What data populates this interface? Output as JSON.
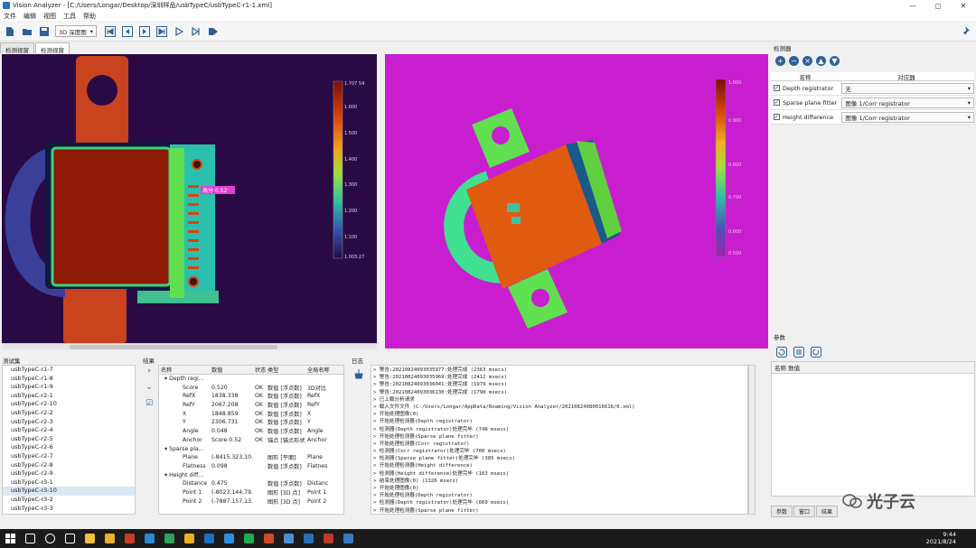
{
  "window": {
    "title": "Vision Analyzer - [C:/Users/Longar/Desktop/深圳样品/usbTypeC/usbTypeC-r1-1.xml]",
    "controls": [
      "—",
      "◻",
      "✕"
    ]
  },
  "menu": [
    "文件",
    "编辑",
    "视图",
    "工具",
    "帮助"
  ],
  "toolbar": {
    "view_combo": "3D 深度图"
  },
  "view_tabs": [
    "检测视窗",
    "检测视窗"
  ],
  "left_view": {
    "scale_labels": [
      "1.707 54",
      "1.600",
      "1.500",
      "1.400",
      "1.300",
      "1.200",
      "1.100",
      "1.003 27"
    ],
    "annotation": "高分 0.52"
  },
  "right_view": {
    "scale_labels": [
      "1.000",
      "0.900",
      "0.800",
      "0.700",
      "0.600",
      "0.500"
    ]
  },
  "detectors": {
    "title": "检测器",
    "buttons": [
      "+",
      "−",
      "×",
      "▲",
      "▼"
    ],
    "col_name": "名称",
    "col_ref": "对应器",
    "rows": [
      {
        "name": "Depth registrator",
        "ref": "无"
      },
      {
        "name": "Sparse plane fitter",
        "ref": "图像   1/Corr registrator"
      },
      {
        "name": "Height difference",
        "ref": "图像   1/Corr registrator"
      }
    ]
  },
  "params": {
    "title": "参数",
    "col_header": "名称  数值",
    "tabs": [
      "参数",
      "窗口",
      "结果"
    ]
  },
  "test_set": {
    "title": "测试集",
    "items": [
      "usbTypeC-r1-7",
      "usbTypeC-r1-8",
      "usbTypeC-r1-9",
      "usbTypeC-r2-1",
      "usbTypeC-r2-10",
      "usbTypeC-r2-2",
      "usbTypeC-r2-3",
      "usbTypeC-r2-4",
      "usbTypeC-r2-5",
      "usbTypeC-r2-6",
      "usbTypeC-r2-7",
      "usbTypeC-r2-8",
      "usbTypeC-r2-9",
      "usbTypeC-r3-1",
      "usbTypeC-r3-10",
      "usbTypeC-r3-2",
      "usbTypeC-r3-3",
      "usbTypeC-r3-4"
    ],
    "selected": "usbTypeC-r3-10"
  },
  "results": {
    "title": "结果",
    "headers": [
      "名称",
      "数值",
      "状态",
      "类型",
      "全局名称"
    ],
    "rows": [
      {
        "name": "▾ Depth regi...",
        "value": "",
        "status": "",
        "type": "",
        "global": ""
      },
      {
        "name": "Score",
        "value": "0.520",
        "status": "OK",
        "type": "数值 [浮点数]",
        "global": "3D对比"
      },
      {
        "name": "RefX",
        "value": "1838.338",
        "status": "OK",
        "type": "数值 [浮点数]",
        "global": "RefX"
      },
      {
        "name": "RefY",
        "value": "2067.208",
        "status": "OK",
        "type": "数值 [浮点数]",
        "global": "RefY"
      },
      {
        "name": "X",
        "value": "1848.859",
        "status": "OK",
        "type": "数值 [浮点数]",
        "global": "X"
      },
      {
        "name": "Y",
        "value": "2306.731",
        "status": "OK",
        "type": "数值 [浮点数]",
        "global": "Y"
      },
      {
        "name": "Angle",
        "value": "0.048",
        "status": "OK",
        "type": "数值 [浮点数]",
        "global": "Angle"
      },
      {
        "name": "Anchor",
        "value": "Score:0.52",
        "status": "OK",
        "type": "锚点 [锚点形状]",
        "global": "Anchor"
      },
      {
        "name": "▾ Sparse pla...",
        "value": "",
        "status": "",
        "type": "",
        "global": ""
      },
      {
        "name": "Plane",
        "value": "(-8415.323,10...",
        "status": "",
        "type": "图形 [平面]",
        "global": "Plane"
      },
      {
        "name": "Flatness",
        "value": "0.098",
        "status": "",
        "type": "数值 [浮点数]",
        "global": "Flatnes"
      },
      {
        "name": "▾ Height diff...",
        "value": "",
        "status": "",
        "type": "",
        "global": ""
      },
      {
        "name": "Distance",
        "value": "0.475",
        "status": "",
        "type": "数值 [浮点数]",
        "global": "Distanc"
      },
      {
        "name": "Point 1",
        "value": "(-8023.144,79...",
        "status": "",
        "type": "图形 [3D 点]",
        "global": "Point 1"
      },
      {
        "name": "Point 2",
        "value": "(-7887.157,13...",
        "status": "",
        "type": "图形 [3D 点]",
        "global": "Point 2"
      }
    ]
  },
  "log": {
    "title": "日志",
    "lines": [
      "> 警告:20210824093035977:处理完成 (2363 msecs)",
      "> 警告:20210824093035969:处理完成 (2412 msecs)",
      "> 警告:20210824093036041:处理完成 (1979 msecs)",
      "> 警告:20210824093036130:处理完成 (1790 msecs)",
      "> 已上载分析请求",
      "> 载入文件文件 (C:/Users/Longar/AppData/Roaming/Vision Analyzer/20210824080016616/0.xml)",
      "> 开始处理图像(0)",
      "> 开始处理检测器(Depth registrator)",
      "> 检测器(Depth registrator)处理完毕 (748 msecs)",
      "> 开始处理检测器(Sparse plane fitter)",
      "> 开始处理检测器(Corr registrator)",
      "> 检测器(Corr registrator)处理完毕 (700 msecs)",
      "> 检测器(Sparse plane fitter)处理完毕 (385 msecs)",
      "> 开始处理检测器(Height difference)",
      "> 检测器(Height difference)处理完毕 (103 msecs)",
      "> 结束处理图像(0) (1326 msecs)",
      "> 开始处理图像(0)",
      "> 开始处理检测器(Depth registrator)",
      "> 检测器(Depth registrator)处理完毕 (669 msecs)",
      "> 开始处理检测器(Sparse plane fitter)",
      "> 检测器(Sparse plane fitter)处理完毕 (136 msecs)",
      "> 开始处理检测器(Height difference)"
    ]
  },
  "watermark": "光子云",
  "taskbar": {
    "time": "9:44",
    "date": "2021/8/24",
    "icon_colors": [
      "#ffffff",
      "#ffffff",
      "#ffffff",
      "#f0c040",
      "#e8b030",
      "#c83c28",
      "#2a8ad0",
      "#30a060",
      "#e8b020",
      "#1e6fc0",
      "#2f8fdd",
      "#1faa50",
      "#d04a2a",
      "#4a90d0",
      "#2a6fb8",
      "#c0392b",
      "#3a78c0"
    ]
  },
  "colors": {
    "accent": "#2f5f9b",
    "left_bg": "#2a0a44",
    "right_bg": "#c81ed0"
  }
}
